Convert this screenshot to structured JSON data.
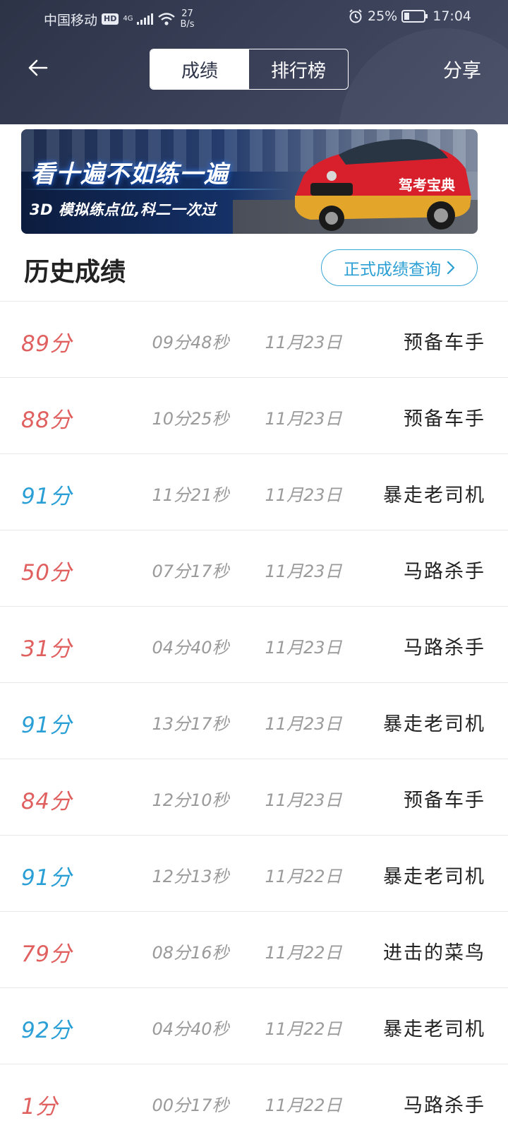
{
  "status_bar": {
    "carrier": "中国移动",
    "hd_badge": "HD",
    "network": "4G",
    "speed_value": "27",
    "speed_unit": "B/s",
    "battery_percent": "25%",
    "battery_level": 0.25,
    "time": "17:04"
  },
  "header": {
    "back_icon": "arrow-left-icon",
    "tabs": [
      {
        "label": "成绩",
        "active": true
      },
      {
        "label": "排行榜",
        "active": false
      }
    ],
    "share_label": "分享"
  },
  "banner": {
    "title": "看十遍不如练一遍",
    "subtitle": "3D 模拟练点位,科二一次过",
    "car_text": "驾考宝典"
  },
  "section": {
    "title": "历史成绩",
    "query_button": "正式成绩查询",
    "query_icon": "chevron-right-icon"
  },
  "colors": {
    "pass_score": "#2a9fd6",
    "fail_score": "#e06060",
    "header_bg": "#2d3347",
    "accent": "#2b9fd4"
  },
  "records": [
    {
      "score": "89分",
      "duration": "09分48秒",
      "date": "11月23日",
      "level": "预备车手",
      "passed": false
    },
    {
      "score": "88分",
      "duration": "10分25秒",
      "date": "11月23日",
      "level": "预备车手",
      "passed": false
    },
    {
      "score": "91分",
      "duration": "11分21秒",
      "date": "11月23日",
      "level": "暴走老司机",
      "passed": true
    },
    {
      "score": "50分",
      "duration": "07分17秒",
      "date": "11月23日",
      "level": "马路杀手",
      "passed": false
    },
    {
      "score": "31分",
      "duration": "04分40秒",
      "date": "11月23日",
      "level": "马路杀手",
      "passed": false
    },
    {
      "score": "91分",
      "duration": "13分17秒",
      "date": "11月23日",
      "level": "暴走老司机",
      "passed": true
    },
    {
      "score": "84分",
      "duration": "12分10秒",
      "date": "11月23日",
      "level": "预备车手",
      "passed": false
    },
    {
      "score": "91分",
      "duration": "12分13秒",
      "date": "11月22日",
      "level": "暴走老司机",
      "passed": true
    },
    {
      "score": "79分",
      "duration": "08分16秒",
      "date": "11月22日",
      "level": "进击的菜鸟",
      "passed": false
    },
    {
      "score": "92分",
      "duration": "04分40秒",
      "date": "11月22日",
      "level": "暴走老司机",
      "passed": true
    },
    {
      "score": "1分",
      "duration": "00分17秒",
      "date": "11月22日",
      "level": "马路杀手",
      "passed": false
    }
  ]
}
